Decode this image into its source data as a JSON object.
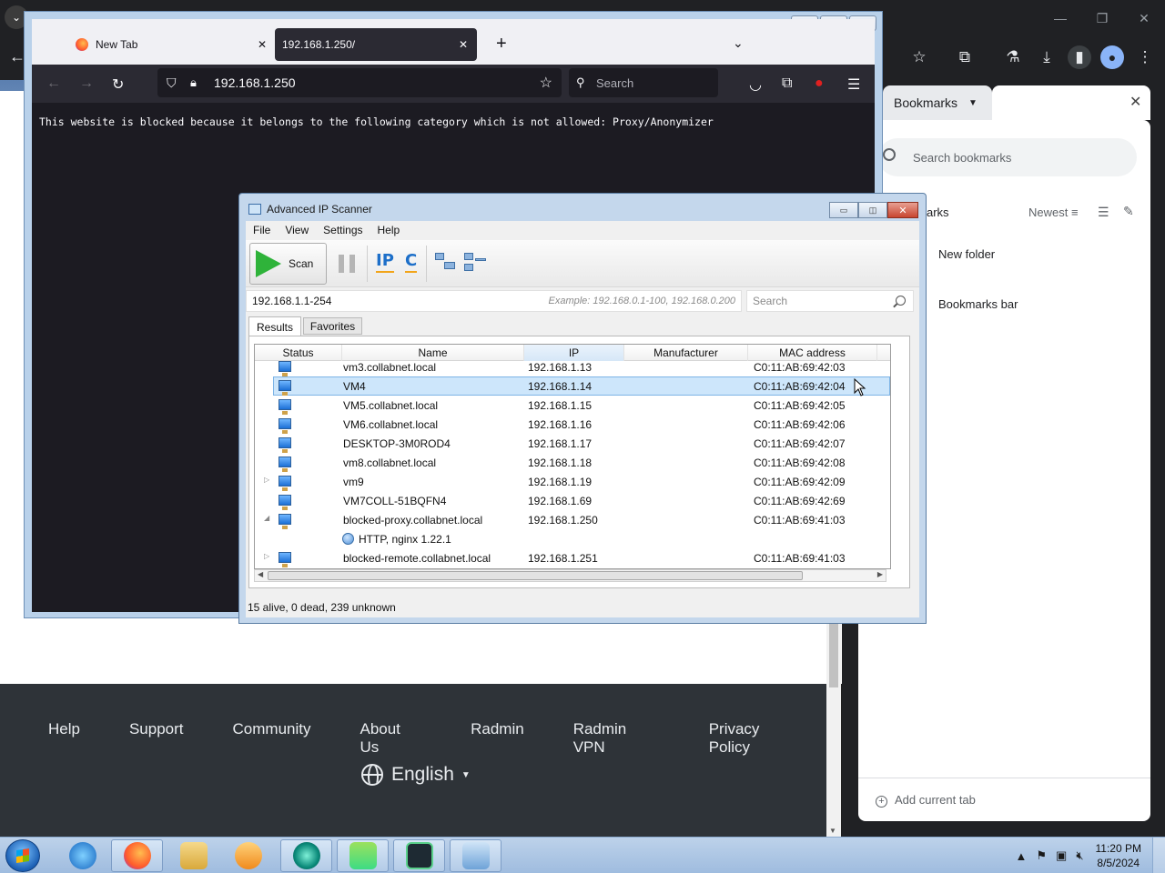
{
  "chrome": {
    "bookmarks_tab": "Bookmarks",
    "bookmarks_search_placeholder": "Search bookmarks",
    "bookmarks_heading": "arks",
    "sort_label": "Newest",
    "items": [
      "New folder",
      "Bookmarks bar"
    ],
    "add_current_tab": "Add current tab"
  },
  "website_footer": {
    "links": [
      "Help",
      "Support",
      "Community",
      "About Us",
      "Radmin",
      "Radmin VPN",
      "Privacy Policy"
    ],
    "language": "English"
  },
  "firefox": {
    "tabs": [
      {
        "label": "New Tab",
        "active": false
      },
      {
        "label": "192.168.1.250/",
        "active": true
      }
    ],
    "url": "192.168.1.250",
    "search_placeholder": "Search",
    "blocked_message": "This website is blocked because it belongs to the following category which is not allowed: Proxy/Anonymizer"
  },
  "ip_scanner": {
    "title": "Advanced IP Scanner",
    "menu": [
      "File",
      "View",
      "Settings",
      "Help"
    ],
    "scan_label": "Scan",
    "toolbar_glyphs": {
      "ip": "IP",
      "c": "C"
    },
    "range_value": "192.168.1.1-254",
    "range_example": "Example: 192.168.0.1-100, 192.168.0.200",
    "search_placeholder": "Search",
    "tabs": [
      "Results",
      "Favorites"
    ],
    "columns": [
      "Status",
      "Name",
      "IP",
      "Manufacturer",
      "MAC address"
    ],
    "rows": [
      {
        "name": "vm3.collabnet.local",
        "ip": "192.168.1.13",
        "mac": "C0:11:AB:69:42:03",
        "expander": ""
      },
      {
        "name": "VM4",
        "ip": "192.168.1.14",
        "mac": "C0:11:AB:69:42:04",
        "expander": "",
        "selected": true
      },
      {
        "name": "VM5.collabnet.local",
        "ip": "192.168.1.15",
        "mac": "C0:11:AB:69:42:05",
        "expander": ""
      },
      {
        "name": "VM6.collabnet.local",
        "ip": "192.168.1.16",
        "mac": "C0:11:AB:69:42:06",
        "expander": ""
      },
      {
        "name": "DESKTOP-3M0ROD4",
        "ip": "192.168.1.17",
        "mac": "C0:11:AB:69:42:07",
        "expander": ""
      },
      {
        "name": "vm8.collabnet.local",
        "ip": "192.168.1.18",
        "mac": "C0:11:AB:69:42:08",
        "expander": ""
      },
      {
        "name": "vm9",
        "ip": "192.168.1.19",
        "mac": "C0:11:AB:69:42:09",
        "expander": "▷"
      },
      {
        "name": "VM7COLL-51BQFN4",
        "ip": "192.168.1.69",
        "mac": "C0:11:AB:69:42:69",
        "expander": ""
      },
      {
        "name": "blocked-proxy.collabnet.local",
        "ip": "192.168.1.250",
        "mac": "C0:11:AB:69:41:03",
        "expander": "◢"
      },
      {
        "service": "HTTP, nginx 1.22.1"
      },
      {
        "name": "blocked-remote.collabnet.local",
        "ip": "192.168.1.251",
        "mac": "C0:11:AB:69:41:03",
        "expander": "▷"
      }
    ],
    "status": "15 alive, 0 dead, 239 unknown"
  },
  "taskbar": {
    "time": "11:20 PM",
    "date": "8/5/2024"
  }
}
